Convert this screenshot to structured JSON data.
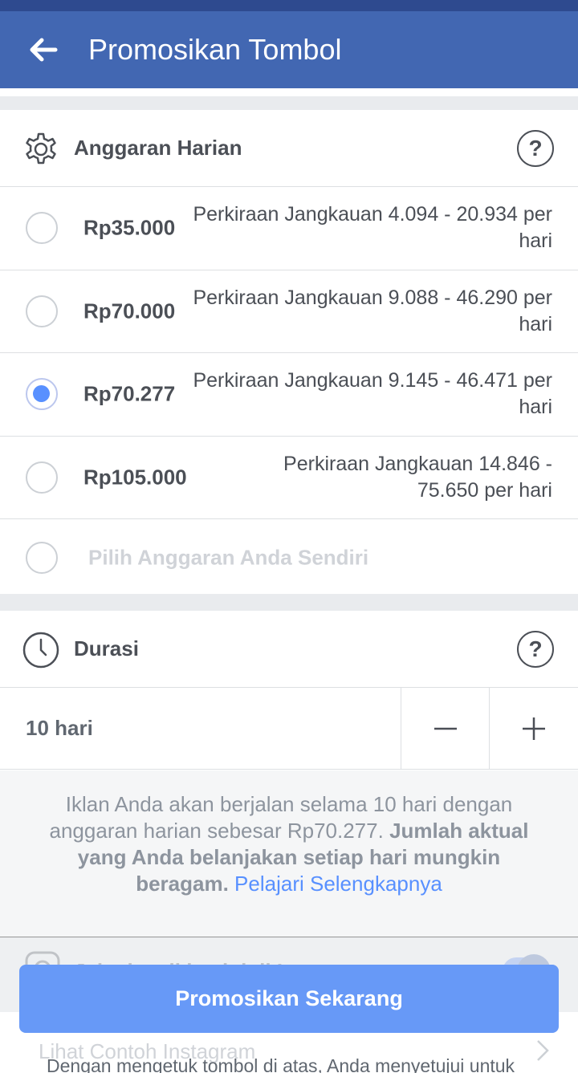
{
  "header": {
    "title": "Promosikan Tombol"
  },
  "budget": {
    "section_label": "Anggaran Harian",
    "options": [
      {
        "price": "Rp35.000",
        "reach": "Perkiraan Jangkauan 4.094 - 20.934 per hari",
        "selected": false
      },
      {
        "price": "Rp70.000",
        "reach": "Perkiraan Jangkauan 9.088 - 46.290 per hari",
        "selected": false
      },
      {
        "price": "Rp70.277",
        "reach": "Perkiraan Jangkauan 9.145 - 46.471 per hari",
        "selected": true
      },
      {
        "price": "Rp105.000",
        "reach": "Perkiraan Jangkauan 14.846 - 75.650 per hari",
        "selected": false
      }
    ],
    "custom_label": "Pilih Anggaran Anda Sendiri"
  },
  "duration": {
    "section_label": "Durasi",
    "value": "10 hari",
    "note_plain": "Iklan Anda akan berjalan selama 10 hari dengan anggaran harian sebesar Rp70.277.",
    "note_bold": "Jumlah aktual yang Anda belanjakan setiap hari mungkin beragam.",
    "note_link": "Pelajari Selengkapnya"
  },
  "instagram": {
    "toggle_label": "Jalankan iklan ini di Instagram",
    "preview_link": "Lihat Contoh Instagram"
  },
  "footer": {
    "cta_label": "Promosikan Sekarang",
    "legal_text": "Dengan mengetuk tombol di atas, Anda menyetujui untuk"
  },
  "colors": {
    "header_bg": "#4267b2",
    "accent": "#5890ff",
    "cta_bg": "#6799f7"
  }
}
